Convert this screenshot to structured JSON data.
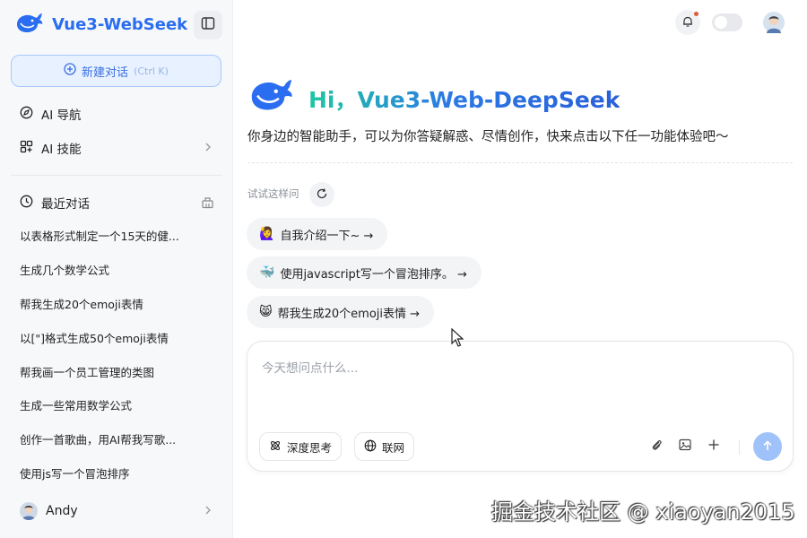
{
  "sidebar": {
    "brand": "Vue3-WebSeek",
    "new_chat_label": "新建对话",
    "new_chat_shortcut": "(Ctrl K)",
    "nav": [
      {
        "label": "AI 导航",
        "icon": "compass-icon"
      },
      {
        "label": "AI 技能",
        "icon": "apps-icon"
      }
    ],
    "recent_title": "最近对话",
    "history": [
      "以表格形式制定一个15天的健...",
      "生成几个数学公式",
      "帮我生成20个emoji表情",
      "以[\"]格式生成50个emoji表情",
      "帮我画一个员工管理的类图",
      "生成一些常用数学公式",
      "创作一首歌曲，用AI帮我写歌...",
      "使用js写一个冒泡排序"
    ],
    "user_name": "Andy"
  },
  "hero": {
    "title": "Hi，Vue3-Web-DeepSeek",
    "subtitle": "你身边的智能助手，可以为你答疑解惑、尽情创作，快来点击以下任一功能体验吧～"
  },
  "suggestions": {
    "label": "试试这样问",
    "items": [
      {
        "emoji": "🙋‍♀️",
        "text": "自我介绍一下~ →"
      },
      {
        "emoji": "🐳",
        "text": "使用javascript写一个冒泡排序。 →"
      },
      {
        "emoji": "😸",
        "text": "帮我生成20个emoji表情 →"
      }
    ]
  },
  "composer": {
    "placeholder": "今天想问点什么...",
    "deep_think_label": "深度思考",
    "web_label": "联网"
  },
  "watermark": "掘金技术社区 @ xiaoyan2015",
  "colors": {
    "brand_blue": "#2a6df0",
    "send_disabled": "#9fc2fb",
    "new_chat_bg": "#e8f1ff"
  }
}
